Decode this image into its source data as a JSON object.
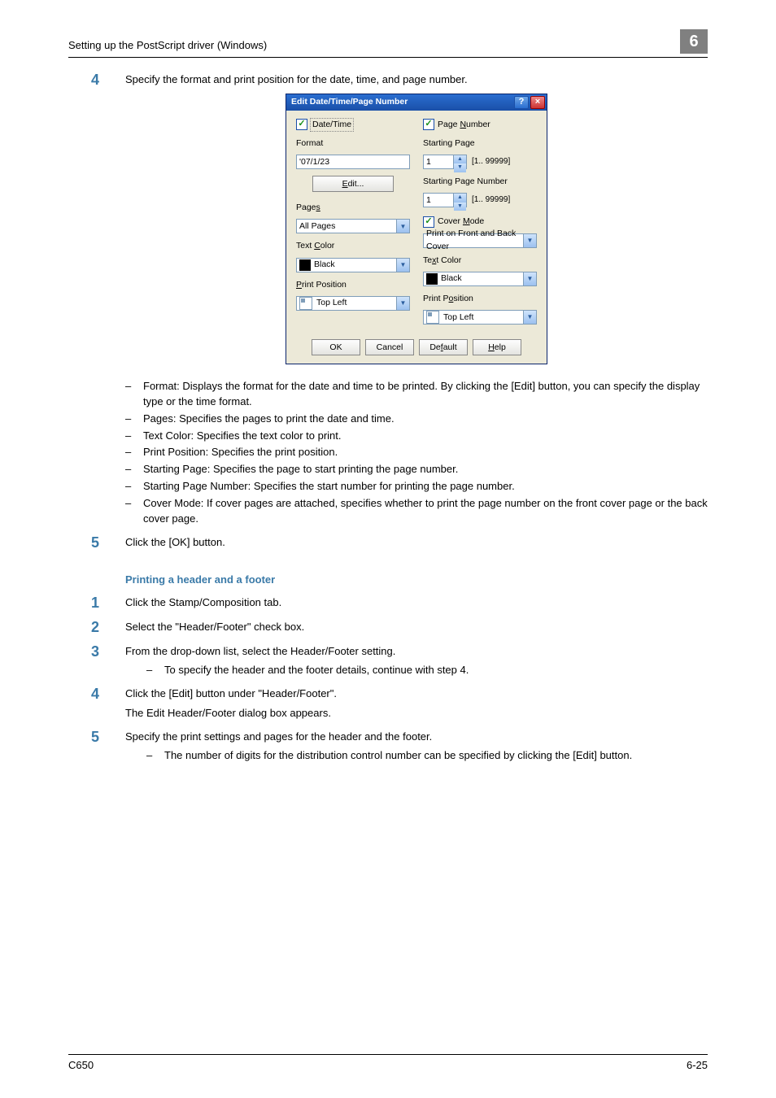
{
  "header": {
    "breadcrumb": "Setting up the PostScript driver (Windows)",
    "chapter": "6"
  },
  "footer": {
    "left": "C650",
    "right": "6-25"
  },
  "dialog": {
    "title": "Edit Date/Time/Page Number",
    "date_time_checked": true,
    "date_time_label": "Date/Time",
    "format_label": "Format",
    "format_value": "'07/1/23",
    "edit_btn": "Edit...",
    "pages_label": "Pages",
    "pages_value": "All Pages",
    "textcolor_label": "Text Color",
    "textcolor_value": "Black",
    "printpos_label": "Print Position",
    "printpos_value": "Top Left",
    "page_number_checked": true,
    "page_number_label": "Page Number",
    "starting_page_label": "Starting Page",
    "starting_page_value": "1",
    "starting_page_range": "[1.. 99999]",
    "starting_pageno_label": "Starting Page Number",
    "starting_pageno_value": "1",
    "starting_pageno_range": "[1.. 99999]",
    "cover_mode_checked": true,
    "cover_mode_label": "Cover Mode",
    "cover_mode_value": "Print on Front and Back Cover",
    "r_textcolor_label": "Text Color",
    "r_textcolor_value": "Black",
    "r_printpos_label": "Print Position",
    "r_printpos_value": "Top Left",
    "ok": "OK",
    "cancel": "Cancel",
    "default": "Default",
    "help": "Help"
  },
  "step4": {
    "n": "4",
    "lead": "Specify the format and print position for the date, time, and page number.",
    "b1": "Format: Displays the format for the date and time to be printed. By clicking the [Edit] button, you can specify the display type or the time format.",
    "b2": "Pages: Specifies the pages to print the date and time.",
    "b3": "Text Color: Specifies the text color to print.",
    "b4": "Print Position: Specifies the print position.",
    "b5": "Starting Page: Specifies the page to start printing the page number.",
    "b6": "Starting Page Number: Specifies the start number for printing the page number.",
    "b7": "Cover Mode: If cover pages are attached, specifies whether to print the page number on the front cover page or the back cover page."
  },
  "step5a": {
    "n": "5",
    "lead": "Click the [OK] button."
  },
  "subhead": "Printing a header and a footer",
  "s1": {
    "n": "1",
    "lead": "Click the Stamp/Composition tab."
  },
  "s2": {
    "n": "2",
    "lead": "Select the \"Header/Footer\" check box."
  },
  "s3": {
    "n": "3",
    "lead": "From the drop-down list, select the Header/Footer setting.",
    "sub": "To specify the header and the footer details, continue with step 4."
  },
  "s4": {
    "n": "4",
    "lead": "Click the [Edit] button under \"Header/Footer\".",
    "extra": "The Edit Header/Footer dialog box appears."
  },
  "s5": {
    "n": "5",
    "lead": "Specify the print settings and pages for the header and the footer.",
    "sub": "The number of digits for the distribution control number can be specified by clicking the [Edit] button."
  }
}
